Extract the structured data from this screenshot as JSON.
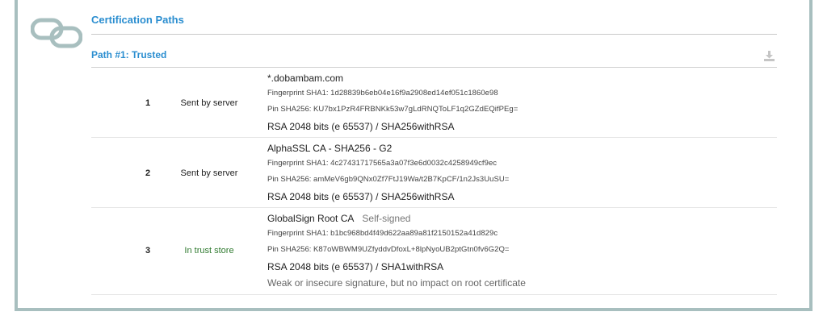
{
  "section": {
    "title": "Certification Paths"
  },
  "path": {
    "title": "Path #1: Trusted"
  },
  "certs": [
    {
      "num": "1",
      "source": "Sent by server",
      "subject": "*.dobambam.com",
      "self_signed": "",
      "fp_label": "Fingerprint SHA1:",
      "fp_value": "1d28839b6eb04e16f9a2908ed14ef051c1860e98",
      "pin_label": "Pin SHA256:",
      "pin_value": "KU7bx1PzR4FRBNKk53w7gLdRNQToLF1q2GZdEQifPEg=",
      "key": "RSA 2048 bits (e 65537) / SHA256withRSA",
      "warning": ""
    },
    {
      "num": "2",
      "source": "Sent by server",
      "subject": "AlphaSSL CA - SHA256 - G2",
      "self_signed": "",
      "fp_label": "Fingerprint SHA1:",
      "fp_value": "4c27431717565a3a07f3e6d0032c4258949cf9ec",
      "pin_label": "Pin SHA256:",
      "pin_value": "amMeV6gb9QNx0Zf7FtJ19Wa/t2B7KpCF/1n2Js3UuSU=",
      "key": "RSA 2048 bits (e 65537) / SHA256withRSA",
      "warning": ""
    },
    {
      "num": "3",
      "source": "In trust store",
      "subject": "GlobalSign Root CA",
      "self_signed": "Self-signed",
      "fp_label": "Fingerprint SHA1:",
      "fp_value": "b1bc968bd4f49d622aa89a81f2150152a41d829c",
      "pin_label": "Pin SHA256:",
      "pin_value": "K87oWBWM9UZfyddvDfoxL+8lpNyoUB2ptGtn0fv6G2Q=",
      "key": "RSA 2048 bits (e 65537) / SHA1withRSA",
      "warning": "Weak or insecure signature, but no impact on root certificate"
    }
  ],
  "icons": {
    "section": "chain-link-icon",
    "download": "download-icon"
  },
  "colors": {
    "accent": "#2b8ed0",
    "frame": "#a8bfbf",
    "trust": "#2f7a2f"
  }
}
